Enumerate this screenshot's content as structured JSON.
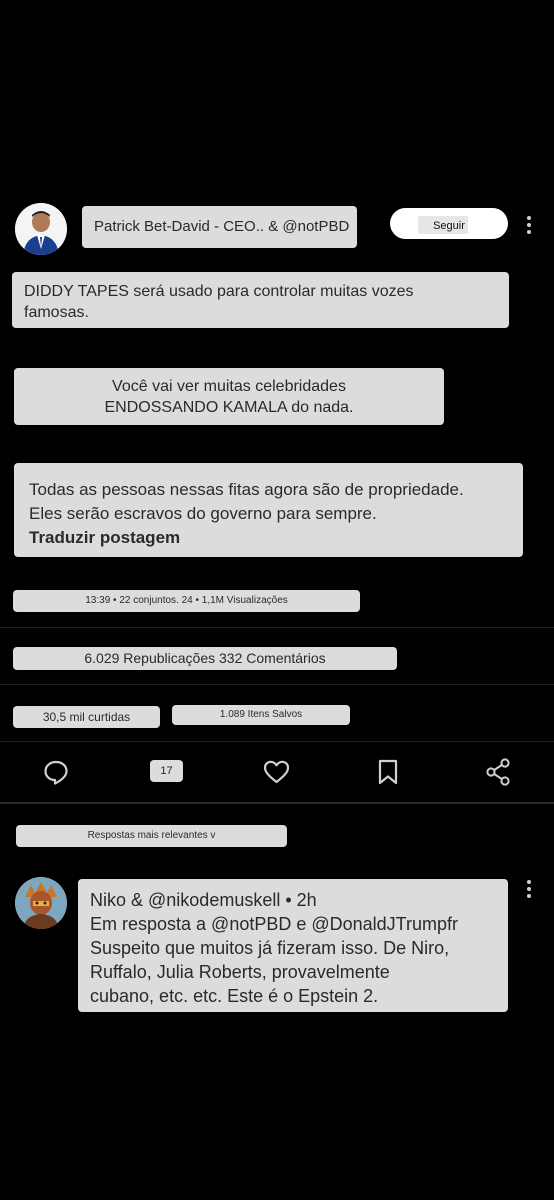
{
  "post": {
    "author": "Patrick Bet-David - CEO.. & @notPBD",
    "follow_label": "Seguir",
    "paragraph1": "DIDDY TAPES será usado para controlar muitas vozes famosas.",
    "paragraph2_line1": "Você vai ver muitas celebridades",
    "paragraph2_line2": "ENDOSSANDO KAMALA do nada.",
    "paragraph3_line1": "Todas as pessoas nessas fitas agora são de propriedade.",
    "paragraph3_line2": "Eles serão escravos do governo para sempre.",
    "translate_label": "Traduzir postagem",
    "meta": "13:39 • 22 conjuntos. 24 • 1,1M Visualizações",
    "reposts_comments": "6.029 Republicações 332 Comentários",
    "likes": "30,5 mil curtidas",
    "saves": "1.089 Itens Salvos"
  },
  "actions": {
    "reply_count": "17"
  },
  "sort_label": "Respostas mais relevantes v",
  "reply": {
    "header": "Niko & @nikodemuskell • 2h",
    "in_reply_to": "Em resposta a @notPBD e @DonaldJTrumpfr",
    "text_line1": "Suspeito que muitos já fizeram isso. De Niro,",
    "text_line2": "Ruffalo, Julia Roberts, provavelmente",
    "text_line3": "cubano, etc. etc. Este é o Epstein 2."
  },
  "colors": {
    "background": "#000000",
    "bubble": "#dcdcdc",
    "icon": "#cfcfcf"
  },
  "icons": [
    "reply-icon",
    "heart-icon",
    "bookmark-icon",
    "share-icon",
    "more-icon"
  ]
}
